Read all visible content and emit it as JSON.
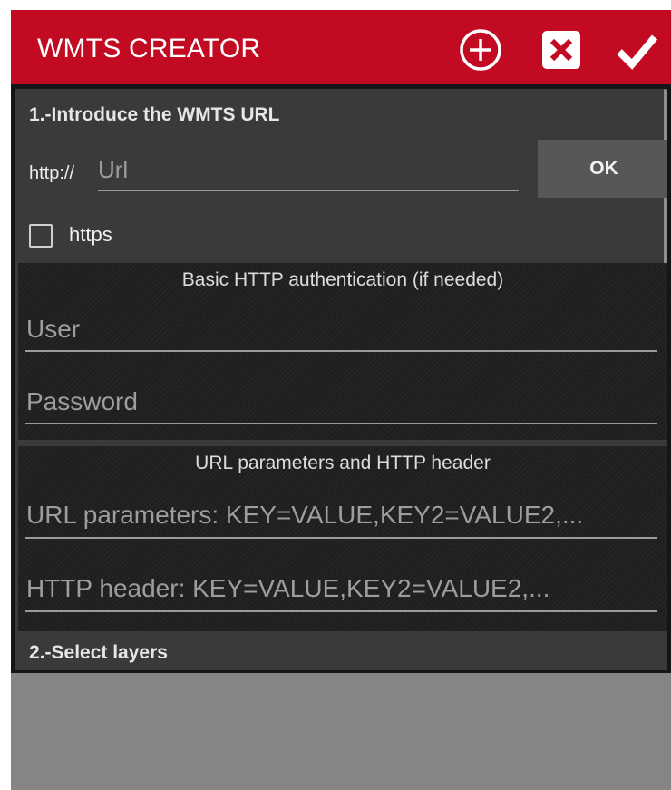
{
  "appbar": {
    "title": "WMTS CREATOR",
    "icons": [
      "add-circle-icon",
      "close-box-icon",
      "checkmark-icon"
    ],
    "color": "#c20a22"
  },
  "step1": {
    "title": "1.-Introduce the WMTS URL",
    "url_prefix": "http://",
    "url_placeholder": "Url",
    "url_value": "",
    "ok_label": "OK",
    "https_label": "https",
    "https_checked": false
  },
  "auth": {
    "title": "Basic HTTP authentication (if needed)",
    "user_placeholder": "User",
    "password_placeholder": "Password"
  },
  "params": {
    "title": "URL parameters and HTTP header",
    "url_params_placeholder": "URL parameters: KEY=VALUE,KEY2=VALUE2,...",
    "http_header_placeholder": "HTTP header: KEY=VALUE,KEY2=VALUE2,..."
  },
  "step2": {
    "title": "2.-Select layers"
  }
}
